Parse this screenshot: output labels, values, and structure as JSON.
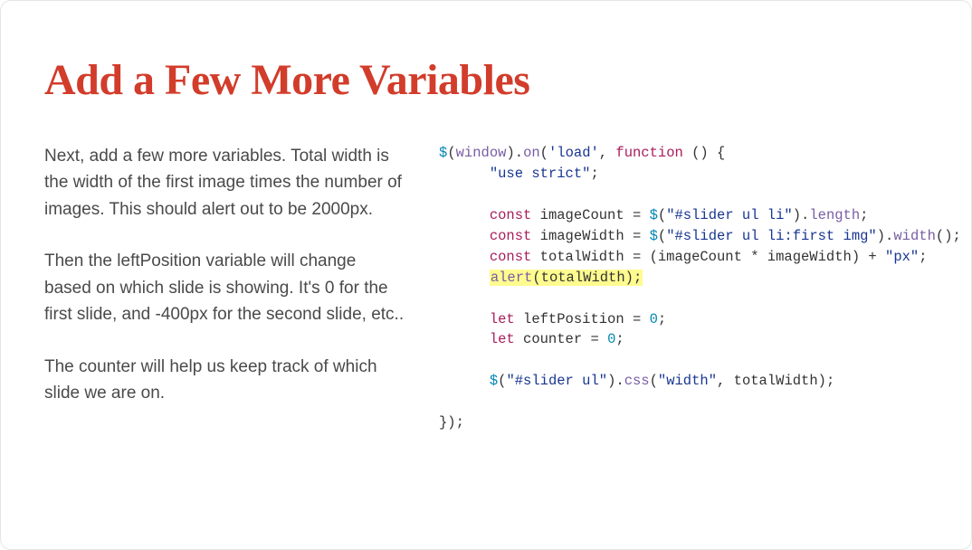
{
  "title": "Add a Few More Variables",
  "paragraphs": {
    "p1": "Next, add a few more variables. Total width is the width of the first image times the number of images. This should alert out to be 2000px.",
    "p2": "Then the leftPosition variable will change based on which slide is showing. It's 0 for the first slide, and -400px for the second slide, etc..",
    "p3": "The counter will help us keep track of which slide we are on."
  },
  "code": {
    "dollar": "$",
    "window": "window",
    "on": "on",
    "load_str": "'load'",
    "function_kw": "function",
    "use_strict": "\"use strict\"",
    "const_kw": "const",
    "let_kw": "let",
    "imageCount": "imageCount",
    "imageWidth": "imageWidth",
    "totalWidth": "totalWidth",
    "leftPosition": "leftPosition",
    "counter": "counter",
    "sel_li": "\"#slider ul li\"",
    "sel_first_img": "\"#slider ul li:first img\"",
    "sel_ul": "\"#slider ul\"",
    "length": "length",
    "width_fn": "width",
    "css_fn": "css",
    "px_str": "\"px\"",
    "width_str": "\"width\"",
    "alert": "alert",
    "zero": "0",
    "open_paren": "(",
    "close_paren": ")",
    "dot": ".",
    "comma": ", ",
    "semi": ";",
    "eq": " = ",
    "star": " * ",
    "plus": " + ",
    "open_brace": " () {",
    "close_wrap": "});"
  }
}
